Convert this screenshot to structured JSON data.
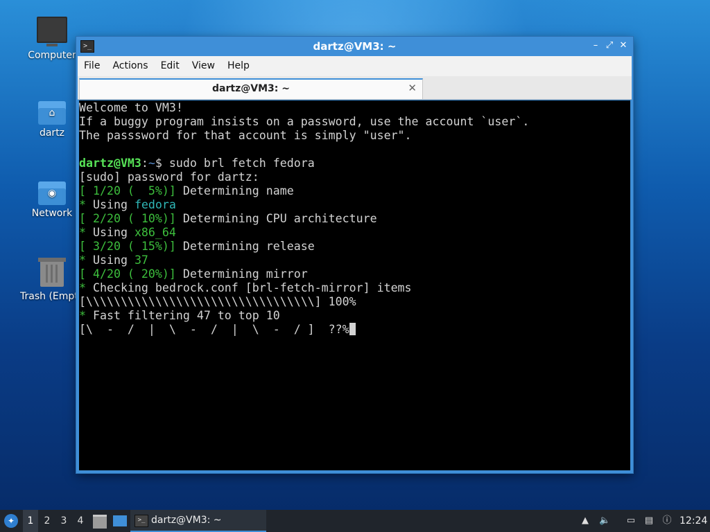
{
  "desktop": {
    "icons": [
      {
        "label": "Computer"
      },
      {
        "label": "dartz"
      },
      {
        "label": "Network"
      },
      {
        "label": "Trash (Empt"
      }
    ]
  },
  "window": {
    "title": "dartz@VM3: ~",
    "controls": {
      "minimize": "–",
      "maximize": "⤢",
      "close": "✕"
    },
    "menu": [
      "File",
      "Actions",
      "Edit",
      "View",
      "Help"
    ],
    "tab": {
      "label": "dartz@VM3: ~",
      "close": "✕"
    }
  },
  "terminal": {
    "motd": [
      "Welcome to VM3!",
      "If a buggy program insists on a password, use the account `user`.",
      "The passsword for that account is simply \"user\"."
    ],
    "prompt_user": "dartz@VM3",
    "prompt_path": "~",
    "command": "sudo brl fetch fedora",
    "sudo_line": "[sudo] password for dartz:",
    "steps": [
      {
        "progress": "[ 1/20 (  5%)]",
        "text": " Determining name"
      },
      {
        "star": "* ",
        "text": "Using ",
        "value": "fedora"
      },
      {
        "progress": "[ 2/20 ( 10%)]",
        "text": " Determining CPU architecture"
      },
      {
        "star": "* ",
        "text": "Using ",
        "value": "x86_64"
      },
      {
        "progress": "[ 3/20 ( 15%)]",
        "text": " Determining release"
      },
      {
        "star": "* ",
        "text": "Using ",
        "value": "37"
      },
      {
        "progress": "[ 4/20 ( 20%)]",
        "text": " Determining mirror"
      },
      {
        "star": "* ",
        "text": "Checking bedrock.conf [brl-fetch-mirror] items"
      }
    ],
    "bar_line": "[\\\\\\\\\\\\\\\\\\\\\\\\\\\\\\\\\\\\\\\\\\\\\\\\\\\\\\\\\\\\\\\\\\] 100%",
    "filter_star": "* ",
    "filter_text": "Fast filtering 47 to top 10",
    "spinner_line": "[\\  -  /  |  \\  -  /  |  \\  -  / ]  ??%"
  },
  "taskbar": {
    "start_icon": "start-menu-icon",
    "workspaces": [
      "1",
      "2",
      "3",
      "4"
    ],
    "active_workspace": "1",
    "task_label": "dartz@VM3: ~",
    "clock": "12:24"
  }
}
